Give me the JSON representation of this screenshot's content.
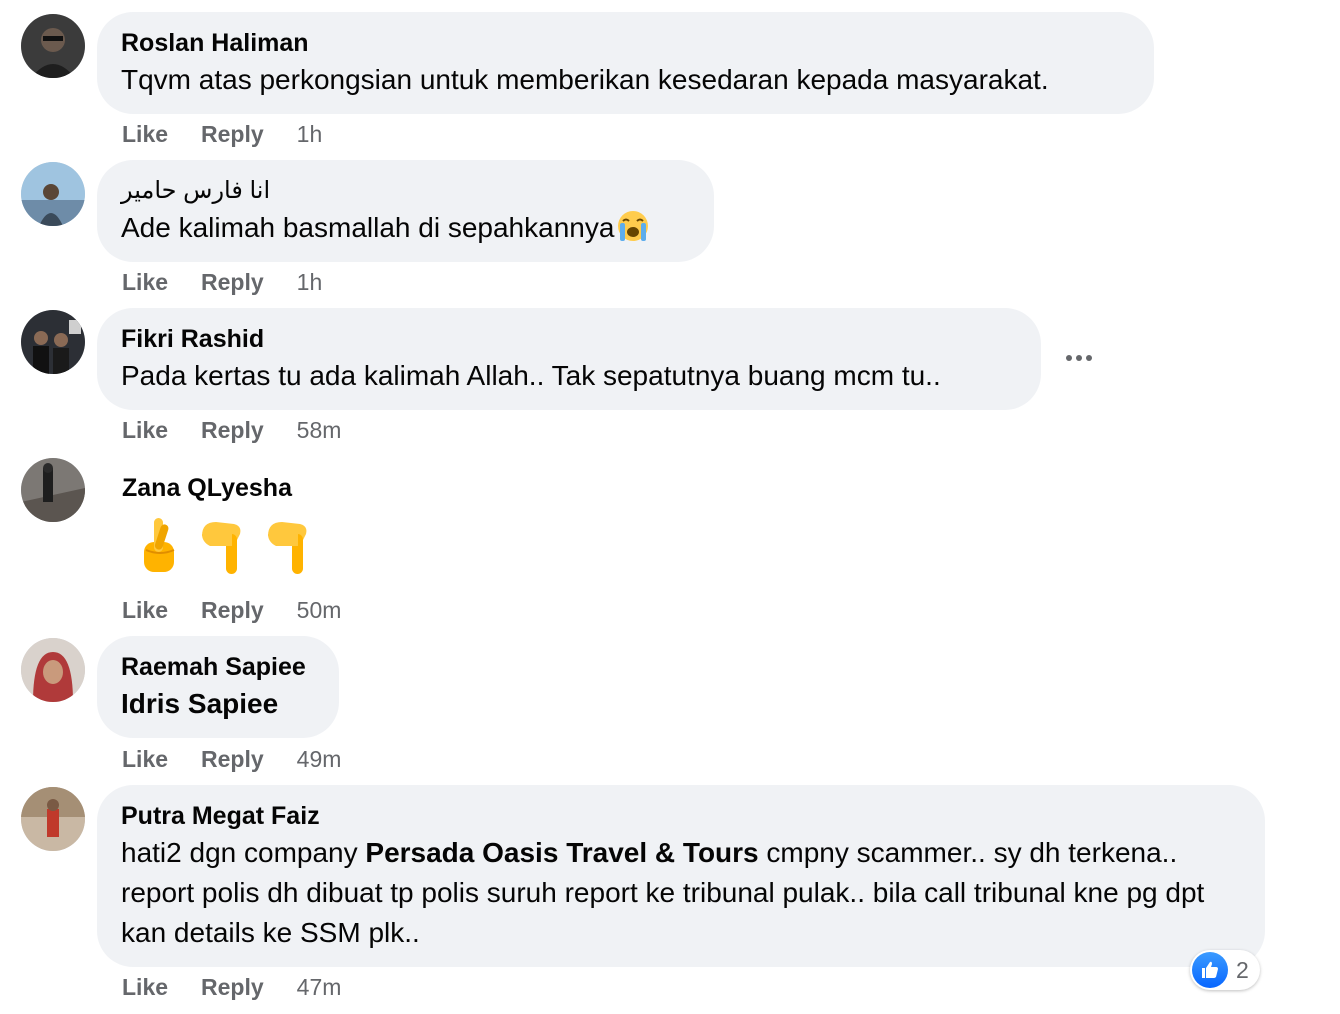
{
  "actions": {
    "like": "Like",
    "reply": "Reply"
  },
  "comments": [
    {
      "author": "Roslan Haliman",
      "text": "Tqvm atas perkongsian untuk memberikan kesedaran kepada masyarakat.",
      "time": "1h"
    },
    {
      "author": "انا فارس حامير",
      "text": "Ade kalimah basmallah di sepahkannya",
      "emoji": "loudly-crying-face",
      "time": "1h"
    },
    {
      "author": "Fikri Rashid",
      "text": "Pada kertas tu ada kalimah Allah.. Tak sepatutnya buang mcm tu..",
      "time": "58m"
    },
    {
      "author": "Zana QLyesha",
      "emojis": [
        "crossed-fingers",
        "pointing-down-hand",
        "pointing-down-hand"
      ],
      "time": "50m"
    },
    {
      "author": "Raemah Sapiee",
      "mention": "Idris Sapiee",
      "time": "49m"
    },
    {
      "author": "Putra Megat Faiz",
      "text_before": "hati2 dgn company ",
      "mention": "Persada Oasis Travel & Tours",
      "text_after": " cmpny scammer.. sy dh terkena.. report polis dh dibuat tp polis suruh report ke tribunal pulak.. bila call tribunal kne pg dpt kan details ke SSM plk..",
      "time": "47m",
      "reactions": {
        "icon": "like-icon",
        "count": "2"
      }
    }
  ],
  "colors": {
    "bubble": "#f0f2f5",
    "meta": "#65676b",
    "like_blue": "#0866ff"
  }
}
